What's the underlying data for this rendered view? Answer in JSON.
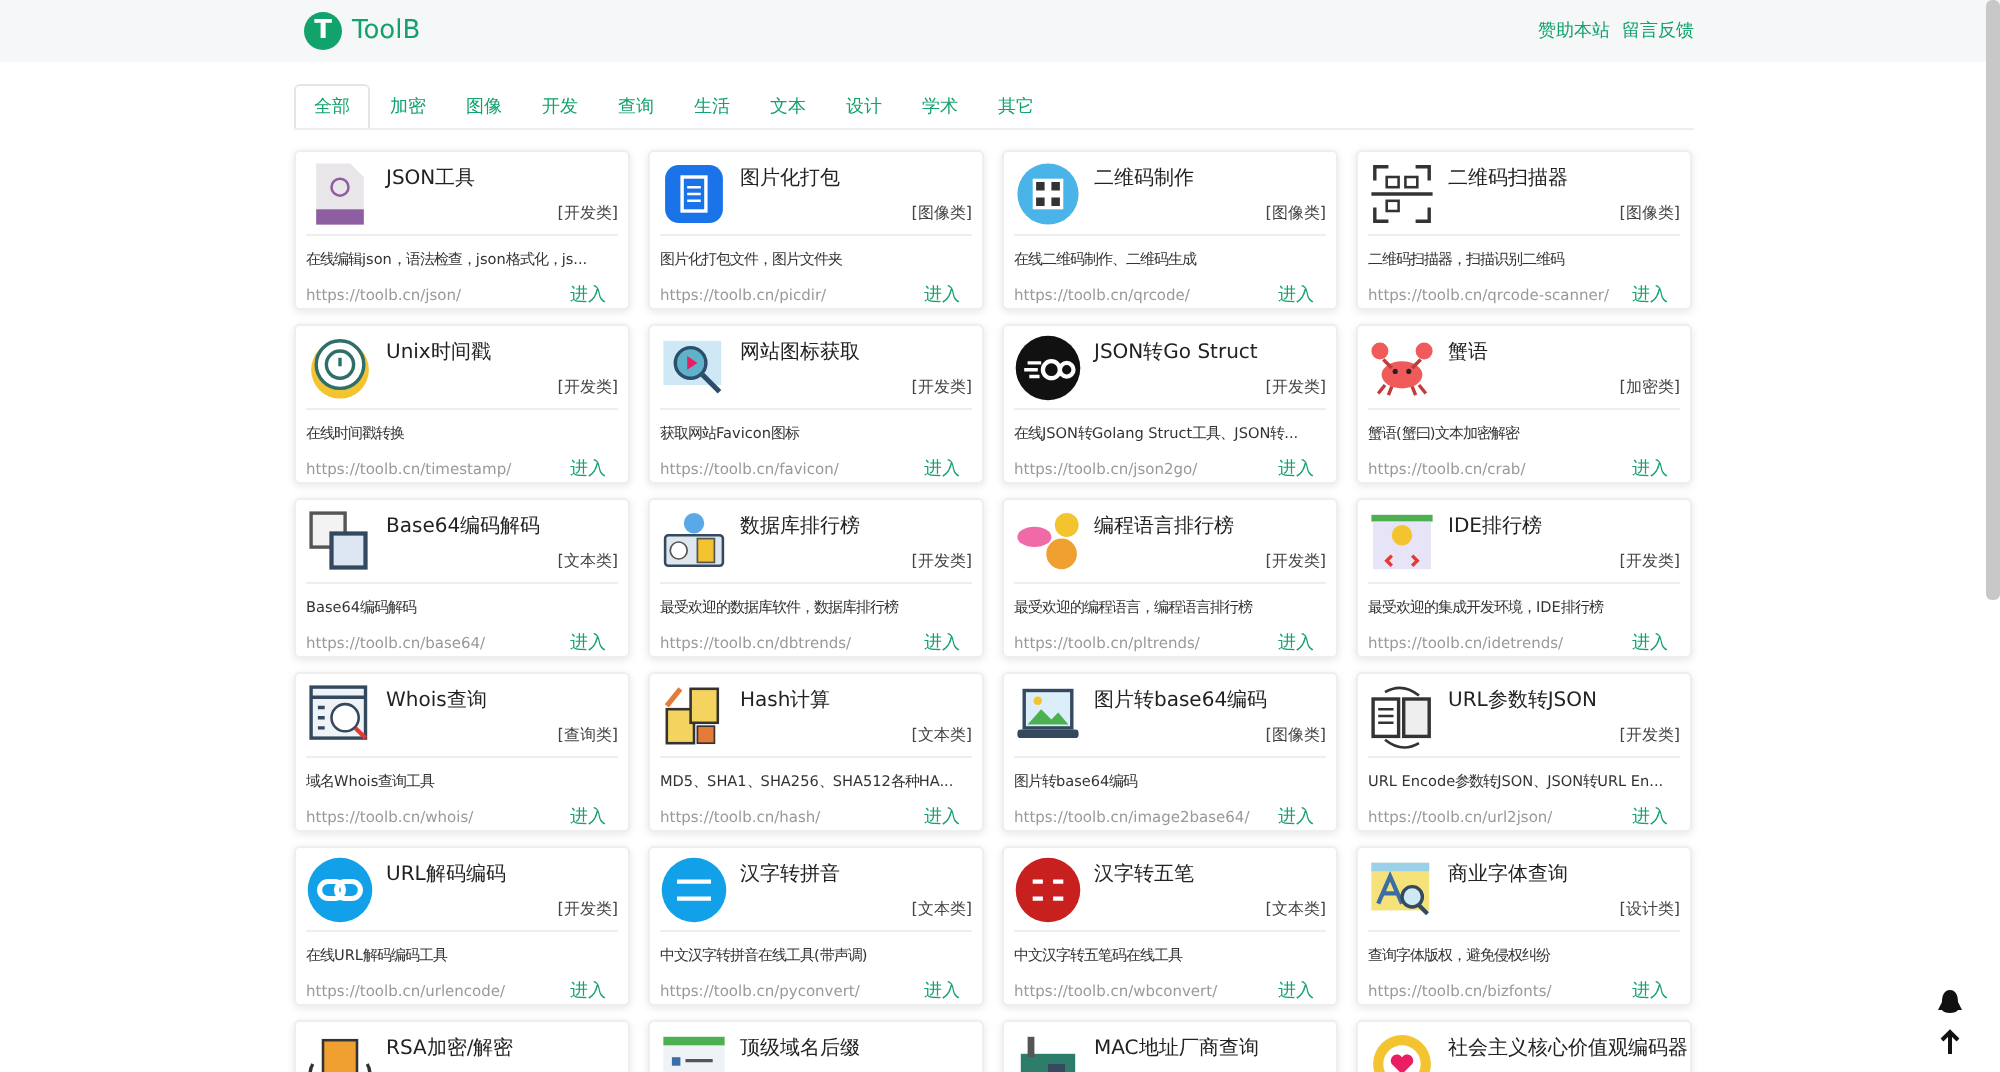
{
  "header": {
    "logo_mark": "T",
    "site_name": "ToolB",
    "links": [
      "赞助本站",
      "留言反馈"
    ]
  },
  "tabs": [
    {
      "label": "全部",
      "selected": true
    },
    {
      "label": "加密",
      "selected": false
    },
    {
      "label": "图像",
      "selected": false
    },
    {
      "label": "开发",
      "selected": false
    },
    {
      "label": "查询",
      "selected": false
    },
    {
      "label": "生活",
      "selected": false
    },
    {
      "label": "文本",
      "selected": false
    },
    {
      "label": "设计",
      "selected": false
    },
    {
      "label": "学术",
      "selected": false
    },
    {
      "label": "其它",
      "selected": false
    }
  ],
  "tools": [
    {
      "title": "JSON工具",
      "category": "[开发类]",
      "description": "在线编辑json，语法检查，json格式化，js...",
      "url": "https://toolb.cn/json/",
      "action": "进入"
    },
    {
      "title": "图片化打包",
      "category": "[图像类]",
      "description": "图片化打包文件，图片文件夹",
      "url": "https://toolb.cn/picdir/",
      "action": "进入"
    },
    {
      "title": "二维码制作",
      "category": "[图像类]",
      "description": "在线二维码制作、二维码生成",
      "url": "https://toolb.cn/qrcode/",
      "action": "进入"
    },
    {
      "title": "二维码扫描器",
      "category": "[图像类]",
      "description": "二维码扫描器，扫描识别二维码",
      "url": "https://toolb.cn/qrcode-scanner/",
      "action": "进入"
    },
    {
      "title": "Unix时间戳",
      "category": "[开发类]",
      "description": "在线时间戳转换",
      "url": "https://toolb.cn/timestamp/",
      "action": "进入"
    },
    {
      "title": "网站图标获取",
      "category": "[开发类]",
      "description": "获取网站Favicon图标",
      "url": "https://toolb.cn/favicon/",
      "action": "进入"
    },
    {
      "title": "JSON转Go Struct",
      "category": "[开发类]",
      "description": "在线JSON转Golang Struct工具、JSON转...",
      "url": "https://toolb.cn/json2go/",
      "action": "进入"
    },
    {
      "title": "蟹语",
      "category": "[加密类]",
      "description": "蟹语(蟹曰)文本加密解密",
      "url": "https://toolb.cn/crab/",
      "action": "进入"
    },
    {
      "title": "Base64编码解码",
      "category": "[文本类]",
      "description": "Base64编码解码",
      "url": "https://toolb.cn/base64/",
      "action": "进入"
    },
    {
      "title": "数据库排行榜",
      "category": "[开发类]",
      "description": "最受欢迎的数据库软件，数据库排行榜",
      "url": "https://toolb.cn/dbtrends/",
      "action": "进入"
    },
    {
      "title": "编程语言排行榜",
      "category": "[开发类]",
      "description": "最受欢迎的编程语言，编程语言排行榜",
      "url": "https://toolb.cn/pltrends/",
      "action": "进入"
    },
    {
      "title": "IDE排行榜",
      "category": "[开发类]",
      "description": "最受欢迎的集成开发环境，IDE排行榜",
      "url": "https://toolb.cn/idetrends/",
      "action": "进入"
    },
    {
      "title": "Whois查询",
      "category": "[查询类]",
      "description": "域名Whois查询工具",
      "url": "https://toolb.cn/whois/",
      "action": "进入"
    },
    {
      "title": "Hash计算",
      "category": "[文本类]",
      "description": "MD5、SHA1、SHA256、SHA512各种HA...",
      "url": "https://toolb.cn/hash/",
      "action": "进入"
    },
    {
      "title": "图片转base64编码",
      "category": "[图像类]",
      "description": "图片转base64编码",
      "url": "https://toolb.cn/image2base64/",
      "action": "进入"
    },
    {
      "title": "URL参数转JSON",
      "category": "[开发类]",
      "description": "URL Encode参数转JSON、JSON转URL En...",
      "url": "https://toolb.cn/url2json/",
      "action": "进入"
    },
    {
      "title": "URL解码编码",
      "category": "[开发类]",
      "description": "在线URL解码编码工具",
      "url": "https://toolb.cn/urlencode/",
      "action": "进入"
    },
    {
      "title": "汉字转拼音",
      "category": "[文本类]",
      "description": "中文汉字转拼音在线工具(带声调)",
      "url": "https://toolb.cn/pyconvert/",
      "action": "进入"
    },
    {
      "title": "汉字转五笔",
      "category": "[文本类]",
      "description": "中文汉字转五笔码在线工具",
      "url": "https://toolb.cn/wbconvert/",
      "action": "进入"
    },
    {
      "title": "商业字体查询",
      "category": "[设计类]",
      "description": "查询字体版权，避免侵权纠纷",
      "url": "https://toolb.cn/bizfonts/",
      "action": "进入"
    },
    {
      "title": "RSA加密/解密"
    },
    {
      "title": "顶级域名后缀"
    },
    {
      "title": "MAC地址厂商查询"
    },
    {
      "title": "社会主义核心价值观编码器"
    }
  ]
}
